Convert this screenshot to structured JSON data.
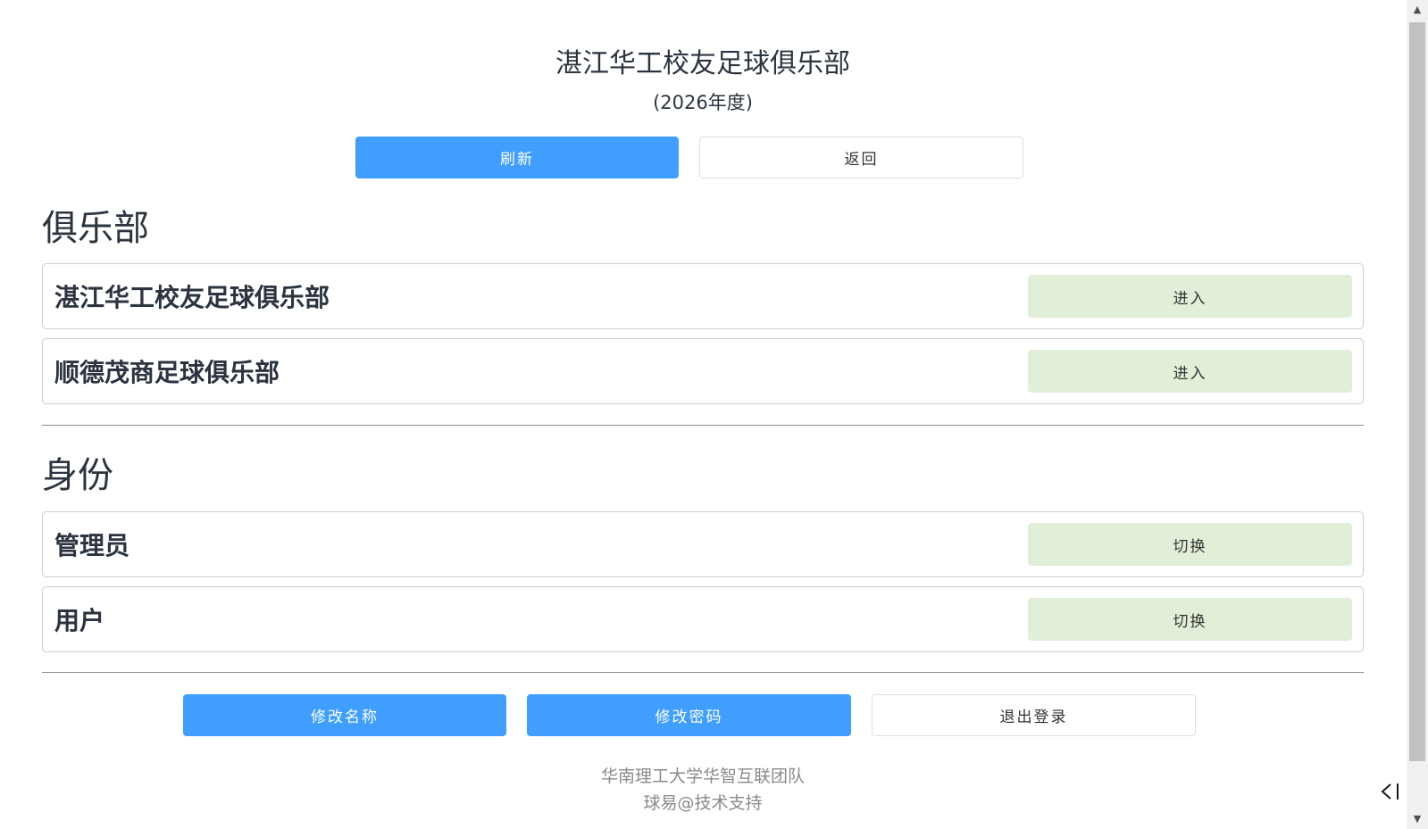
{
  "header": {
    "title": "湛江华工校友足球俱乐部",
    "subtitle": "(2026年度)"
  },
  "top_actions": {
    "refresh_label": "刷新",
    "back_label": "返回"
  },
  "clubs": {
    "heading": "俱乐部",
    "items": [
      {
        "name": "湛江华工校友足球俱乐部",
        "action_label": "进入"
      },
      {
        "name": "顺德茂商足球俱乐部",
        "action_label": "进入"
      }
    ]
  },
  "identity": {
    "heading": "身份",
    "items": [
      {
        "name": "管理员",
        "action_label": "切换"
      },
      {
        "name": "用户",
        "action_label": "切换"
      }
    ]
  },
  "bottom_actions": {
    "rename_label": "修改名称",
    "change_password_label": "修改密码",
    "logout_label": "退出登录"
  },
  "footer": {
    "line1": "华南理工大学华智互联团队",
    "line2": "球易@技术支持"
  },
  "icons": {
    "side_toggle": "collapse-left-icon",
    "scroll_up": "scroll-up-arrow-icon",
    "scroll_down": "scroll-down-arrow-icon"
  },
  "colors": {
    "primary": "#409eff",
    "light_action": "#e1eed8",
    "text": "#2c3440",
    "footer_text": "#8a8a8a"
  }
}
